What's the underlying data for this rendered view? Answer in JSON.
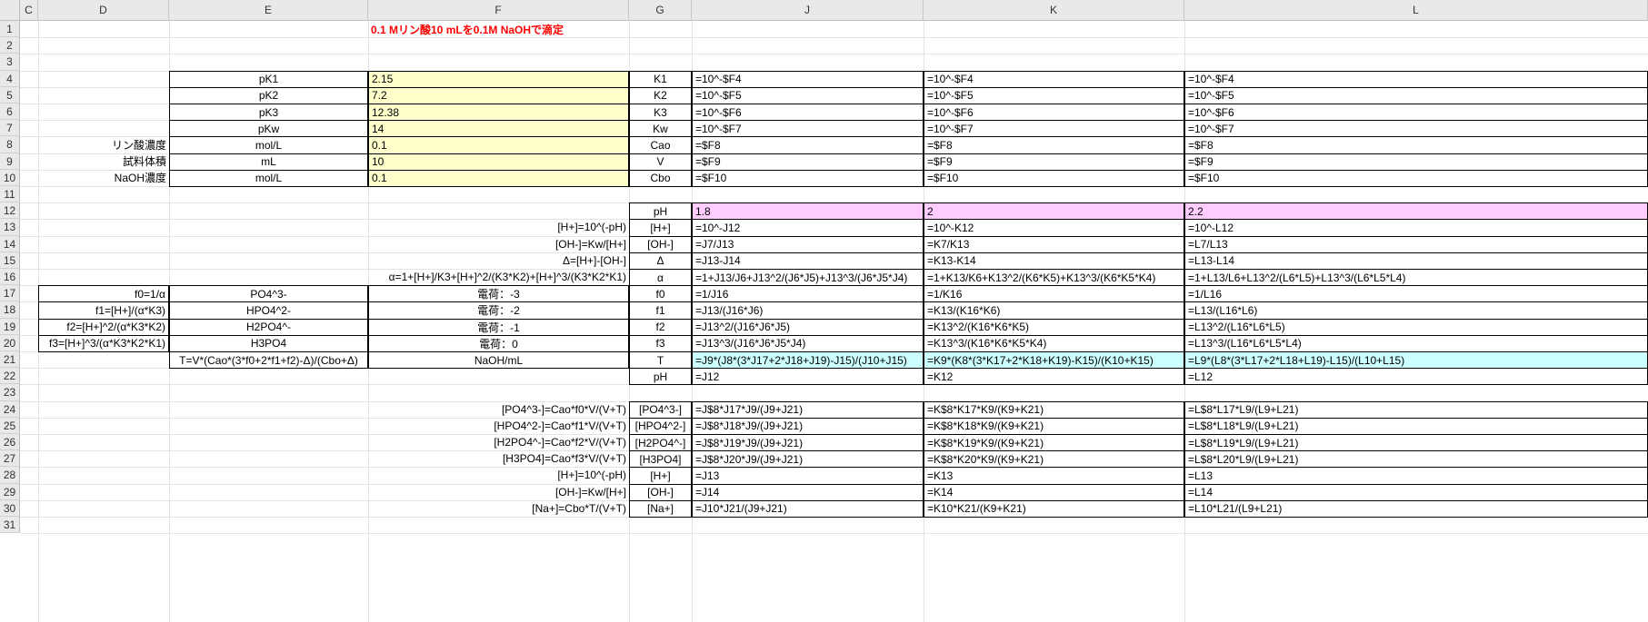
{
  "sheet": {
    "column_headers": [
      "C",
      "D",
      "E",
      "F",
      "G",
      "J",
      "K",
      "L"
    ],
    "row_numbers": [
      "1",
      "2",
      "3",
      "4",
      "5",
      "6",
      "7",
      "8",
      "9",
      "10",
      "11",
      "12",
      "13",
      "14",
      "15",
      "16",
      "17",
      "18",
      "19",
      "20",
      "21",
      "22",
      "23",
      "24",
      "25",
      "26",
      "27",
      "28",
      "29",
      "30",
      "31"
    ]
  },
  "title": "0.1 Mリン酸10 mLを0.1M NaOHで滴定",
  "params": [
    {
      "d": "",
      "e": "pK1",
      "f": "2.15",
      "g": "K1",
      "j": "=10^-$F4",
      "k": "=10^-$F4",
      "l": "=10^-$F4"
    },
    {
      "d": "",
      "e": "pK2",
      "f": "7.2",
      "g": "K2",
      "j": "=10^-$F5",
      "k": "=10^-$F5",
      "l": "=10^-$F5"
    },
    {
      "d": "",
      "e": "pK3",
      "f": "12.38",
      "g": "K3",
      "j": "=10^-$F6",
      "k": "=10^-$F6",
      "l": "=10^-$F6"
    },
    {
      "d": "",
      "e": "pKw",
      "f": "14",
      "g": "Kw",
      "j": "=10^-$F7",
      "k": "=10^-$F7",
      "l": "=10^-$F7"
    },
    {
      "d": "リン酸濃度",
      "e": "mol/L",
      "f": "0.1",
      "g": "Cao",
      "j": "=$F8",
      "k": "=$F8",
      "l": "=$F8"
    },
    {
      "d": "試料体積",
      "e": "mL",
      "f": "10",
      "g": "V",
      "j": "=$F9",
      "k": "=$F9",
      "l": "=$F9"
    },
    {
      "d": "NaOH濃度",
      "e": "mol/L",
      "f": "0.1",
      "g": "Cbo",
      "j": "=$F10",
      "k": "=$F10",
      "l": "=$F10"
    }
  ],
  "calc": [
    {
      "d": "",
      "e": "",
      "f": "",
      "g": "pH",
      "j": "1.8",
      "k": "2",
      "l": "2.2"
    },
    {
      "d": "",
      "e": "",
      "f": "[H+]=10^(-pH)",
      "g": "[H+]",
      "j": "=10^-J12",
      "k": "=10^-K12",
      "l": "=10^-L12"
    },
    {
      "d": "",
      "e": "",
      "f": "[OH-]=Kw/[H+]",
      "g": "[OH-]",
      "j": "=J7/J13",
      "k": "=K7/K13",
      "l": "=L7/L13"
    },
    {
      "d": "",
      "e": "",
      "f": "Δ=[H+]-[OH-]",
      "g": "Δ",
      "j": "=J13-J14",
      "k": "=K13-K14",
      "l": "=L13-L14"
    },
    {
      "d": "",
      "e": "",
      "f": "α=1+[H+]/K3+[H+]^2/(K3*K2)+[H+]^3/(K3*K2*K1)",
      "g": "α",
      "j": "=1+J13/J6+J13^2/(J6*J5)+J13^3/(J6*J5*J4)",
      "k": "=1+K13/K6+K13^2/(K6*K5)+K13^3/(K6*K5*K4)",
      "l": "=1+L13/L6+L13^2/(L6*L5)+L13^3/(L6*L5*L4)"
    },
    {
      "d": "f0=1/α",
      "e": "PO4^3-",
      "f": "電荷：-3",
      "g": "f0",
      "j": "=1/J16",
      "k": "=1/K16",
      "l": "=1/L16"
    },
    {
      "d": "f1=[H+]/(α*K3)",
      "e": "HPO4^2-",
      "f": "電荷：-2",
      "g": "f1",
      "j": "=J13/(J16*J6)",
      "k": "=K13/(K16*K6)",
      "l": "=L13/(L16*L6)"
    },
    {
      "d": "f2=[H+]^2/(α*K3*K2)",
      "e": "H2PO4^-",
      "f": "電荷：-1",
      "g": "f2",
      "j": "=J13^2/(J16*J6*J5)",
      "k": "=K13^2/(K16*K6*K5)",
      "l": "=L13^2/(L16*L6*L5)"
    },
    {
      "d": "f3=[H+]^3/(α*K3*K2*K1)",
      "e": "H3PO4",
      "f": "電荷：0",
      "g": "f3",
      "j": "=J13^3/(J16*J6*J5*J4)",
      "k": "=K13^3/(K16*K6*K5*K4)",
      "l": "=L13^3/(L16*L6*L5*L4)"
    },
    {
      "d": "",
      "e": "T=V*(Cao*(3*f0+2*f1+f2)-Δ)/(Cbo+Δ)",
      "f": "NaOH/mL",
      "g": "T",
      "j": "=J9*(J8*(3*J17+2*J18+J19)-J15)/(J10+J15)",
      "k": "=K9*(K8*(3*K17+2*K18+K19)-K15)/(K10+K15)",
      "l": "=L9*(L8*(3*L17+2*L18+L19)-L15)/(L10+L15)"
    },
    {
      "d": "",
      "e": "",
      "f": "",
      "g": "pH",
      "j": "=J12",
      "k": "=K12",
      "l": "=L12"
    }
  ],
  "species": [
    {
      "f": "[PO4^3-]=Cao*f0*V/(V+T)",
      "g": "[PO4^3-]",
      "j": "=J$8*J17*J9/(J9+J21)",
      "k": "=K$8*K17*K9/(K9+K21)",
      "l": "=L$8*L17*L9/(L9+L21)"
    },
    {
      "f": "[HPO4^2-]=Cao*f1*V/(V+T)",
      "g": "[HPO4^2-]",
      "j": "=J$8*J18*J9/(J9+J21)",
      "k": "=K$8*K18*K9/(K9+K21)",
      "l": "=L$8*L18*L9/(L9+L21)"
    },
    {
      "f": "[H2PO4^-]=Cao*f2*V/(V+T)",
      "g": "[H2PO4^-]",
      "j": "=J$8*J19*J9/(J9+J21)",
      "k": "=K$8*K19*K9/(K9+K21)",
      "l": "=L$8*L19*L9/(L9+L21)"
    },
    {
      "f": "[H3PO4]=Cao*f3*V/(V+T)",
      "g": "[H3PO4]",
      "j": "=J$8*J20*J9/(J9+J21)",
      "k": "=K$8*K20*K9/(K9+K21)",
      "l": "=L$8*L20*L9/(L9+L21)"
    },
    {
      "f": "[H+]=10^(-pH)",
      "g": "[H+]",
      "j": "=J13",
      "k": "=K13",
      "l": "=L13"
    },
    {
      "f": "[OH-]=Kw/[H+]",
      "g": "[OH-]",
      "j": "=J14",
      "k": "=K14",
      "l": "=L14"
    },
    {
      "f": "[Na+]=Cbo*T/(V+T)",
      "g": "[Na+]",
      "j": "=J10*J21/(J9+J21)",
      "k": "=K10*K21/(K9+K21)",
      "l": "=L10*L21/(L9+L21)"
    }
  ]
}
